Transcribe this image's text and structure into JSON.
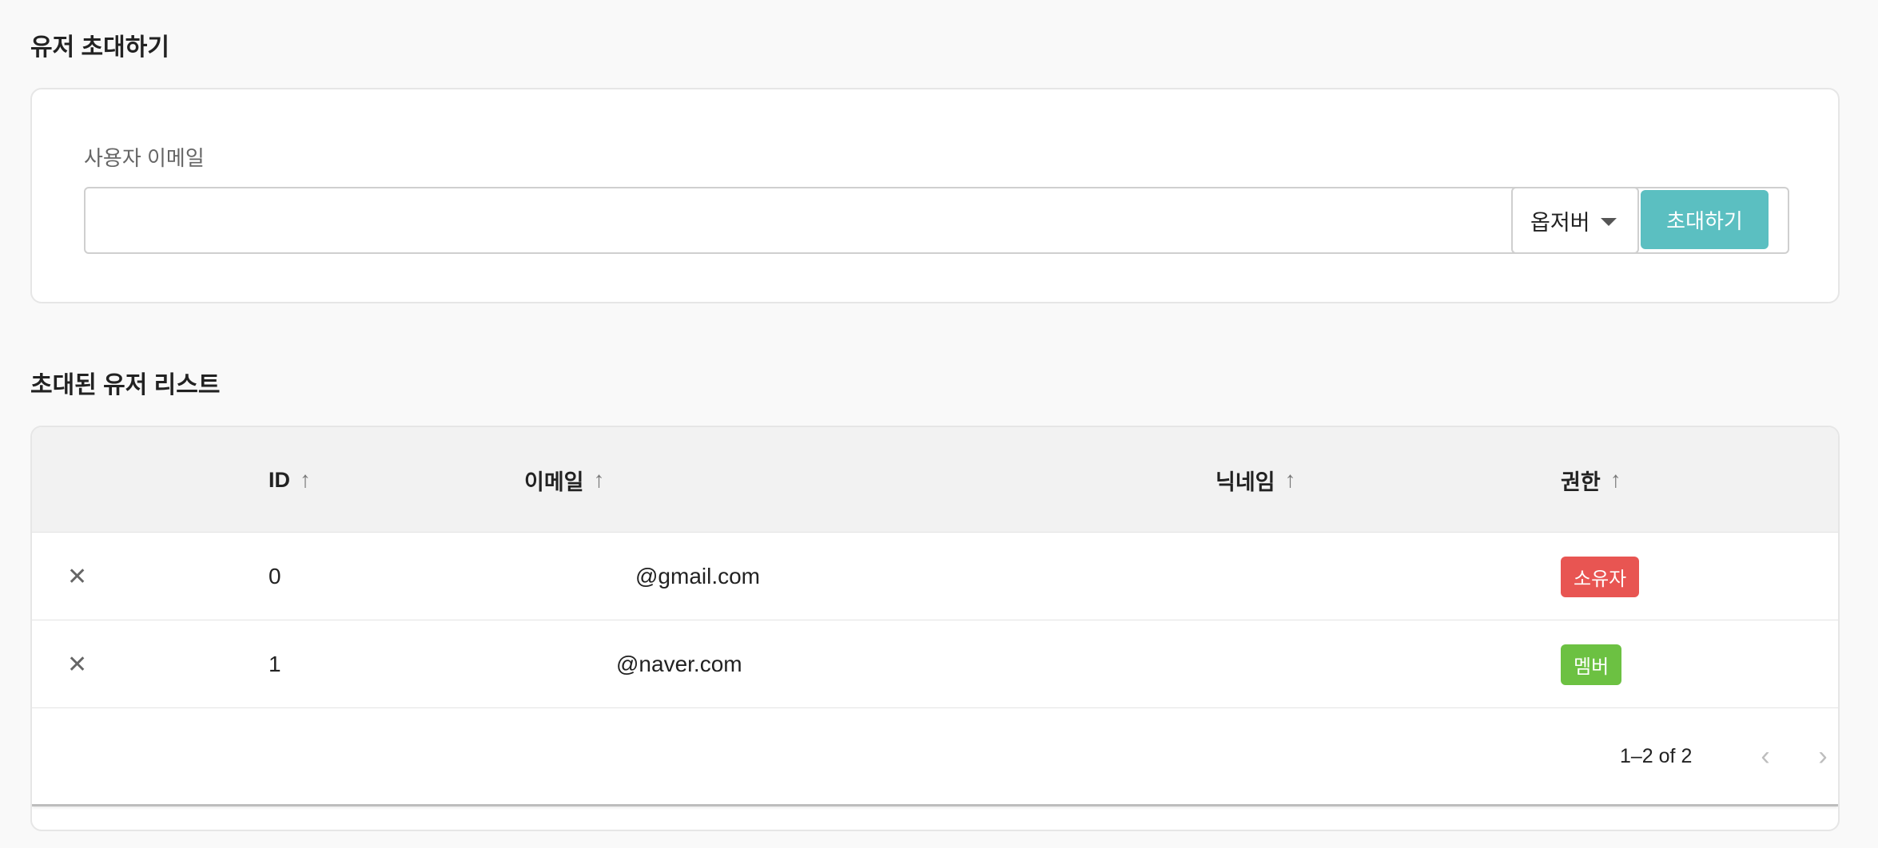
{
  "invite_section": {
    "title": "유저 초대하기",
    "email_label": "사용자 이메일",
    "email_value": "",
    "role_selected": "옵저버",
    "invite_button": "초대하기",
    "caret_icon": "caret-down-icon"
  },
  "list_section": {
    "title": "초대된 유저 리스트",
    "columns": [
      {
        "label": "ID",
        "sort_icon": "arrow-up-icon"
      },
      {
        "label": "이메일",
        "sort_icon": "arrow-up-icon"
      },
      {
        "label": "닉네임",
        "sort_icon": "arrow-up-icon"
      },
      {
        "label": "권한",
        "sort_icon": "arrow-up-icon"
      }
    ],
    "rows": [
      {
        "delete_icon": "close-icon",
        "id": "0",
        "email": "@gmail.com",
        "nickname": "",
        "role": "소유자",
        "role_color": "#e85552"
      },
      {
        "delete_icon": "close-icon",
        "id": "1",
        "email": "@naver.com",
        "nickname": "",
        "role": "멤버",
        "role_color": "#6cc142"
      }
    ],
    "pagination": {
      "range_text": "1–2 of 2",
      "prev_icon": "chevron-left-icon",
      "next_icon": "chevron-right-icon"
    }
  },
  "colors": {
    "accent": "#5bbfc1",
    "background": "#f9f9f9",
    "header_bg": "#f2f2f2"
  }
}
